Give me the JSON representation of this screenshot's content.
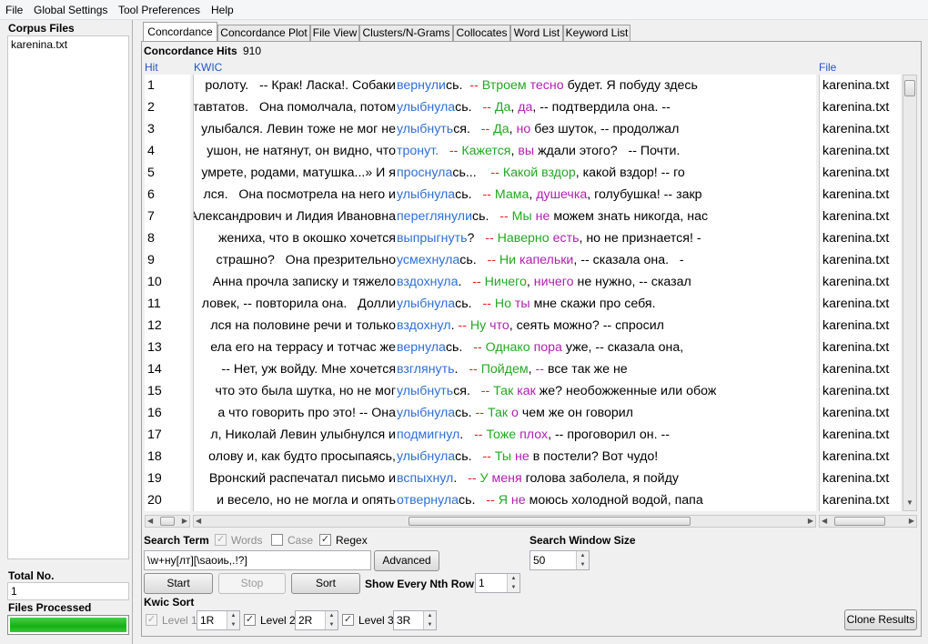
{
  "menu": [
    "File",
    "Global Settings",
    "Tool Preferences",
    "Help"
  ],
  "left": {
    "corpus_title": "Corpus Files",
    "files": [
      "karenina.txt"
    ],
    "total_label": "Total No.",
    "total_value": "1",
    "processed_label": "Files Processed",
    "progress": 1.0
  },
  "tabs": [
    "Concordance",
    "Concordance Plot",
    "File View",
    "Clusters/N-Grams",
    "Collocates",
    "Word List",
    "Keyword List"
  ],
  "hits": {
    "label": "Concordance Hits",
    "value": "910"
  },
  "columns": {
    "hit": "Hit",
    "kwic": "KWIC",
    "file": "File"
  },
  "rows": [
    {
      "hit": "1",
      "left": "ролоту.   -- Крак! Ласка!. Собаки",
      "right": [
        [
          "вернули",
          "blue"
        ],
        [
          "сь.  ",
          ""
        ],
        [
          "-- ",
          "red"
        ],
        [
          "Втроем ",
          "green"
        ],
        [
          "тесно",
          "purple"
        ],
        [
          " будет. Я побуду здесь",
          ""
        ]
      ],
      "file": "karenina.txt"
    },
    {
      "hit": "2",
      "left": "ставтатов.   Она помолчала, потом",
      "right": [
        [
          "улыбнула",
          "blue"
        ],
        [
          "сь.   ",
          ""
        ],
        [
          "-- ",
          "red"
        ],
        [
          "Да",
          "green"
        ],
        [
          ", ",
          ""
        ],
        [
          "да",
          "purple"
        ],
        [
          ", -- подтвердила она. --",
          ""
        ]
      ],
      "file": "karenina.txt"
    },
    {
      "hit": "3",
      "left": "улыбался. Левин тоже не мог не",
      "right": [
        [
          "улыбнуть",
          "blue"
        ],
        [
          "ся.   ",
          ""
        ],
        [
          "-- ",
          "red"
        ],
        [
          "Да",
          "green"
        ],
        [
          ", ",
          ""
        ],
        [
          "но",
          "purple"
        ],
        [
          " без шуток, -- продолжал",
          ""
        ]
      ],
      "file": "karenina.txt"
    },
    {
      "hit": "4",
      "left": "ушон, не натянут, он видно, что",
      "right": [
        [
          "тронут.",
          "blue"
        ],
        [
          "   ",
          ""
        ],
        [
          "-- ",
          "red"
        ],
        [
          "Кажется",
          "green"
        ],
        [
          ", ",
          ""
        ],
        [
          "вы",
          "purple"
        ],
        [
          " ждали этого?   -- Почти.",
          ""
        ]
      ],
      "file": "karenina.txt"
    },
    {
      "hit": "5",
      "left": "умрете, родами, матушка...» И я",
      "right": [
        [
          "проснула",
          "blue"
        ],
        [
          "сь...    ",
          ""
        ],
        [
          "-- ",
          "red"
        ],
        [
          "Какой вздор",
          "green"
        ],
        [
          ", какой вздор! -- го",
          ""
        ]
      ],
      "file": "karenina.txt"
    },
    {
      "hit": "6",
      "left": "лся.   Она посмотрела на него и",
      "right": [
        [
          "улыбнула",
          "blue"
        ],
        [
          "сь.   ",
          ""
        ],
        [
          "-- ",
          "red"
        ],
        [
          "Мама",
          "green"
        ],
        [
          ", ",
          ""
        ],
        [
          "душечка",
          "purple"
        ],
        [
          ", голубушка! -- закр",
          ""
        ]
      ],
      "file": "karenina.txt"
    },
    {
      "hit": "7",
      "left": "Александрович и Лидия Ивановна",
      "right": [
        [
          "переглянули",
          "blue"
        ],
        [
          "сь.   ",
          ""
        ],
        [
          "-- ",
          "red"
        ],
        [
          "Мы ",
          "green"
        ],
        [
          "не",
          "purple"
        ],
        [
          " можем знать никогда, нас",
          ""
        ]
      ],
      "file": "karenina.txt"
    },
    {
      "hit": "8",
      "left": "жениха, что в окошко хочется",
      "right": [
        [
          "выпрыгнуть",
          "blue"
        ],
        [
          "?   ",
          ""
        ],
        [
          "-- ",
          "red"
        ],
        [
          "Наверно ",
          "green"
        ],
        [
          "есть",
          "purple"
        ],
        [
          ", но не признается! -",
          ""
        ]
      ],
      "file": "karenina.txt"
    },
    {
      "hit": "9",
      "left": "страшно?   Она презрительно",
      "right": [
        [
          "усмехнула",
          "blue"
        ],
        [
          "сь.   ",
          ""
        ],
        [
          "-- ",
          "red"
        ],
        [
          "Ни ",
          "green"
        ],
        [
          "капельки",
          "purple"
        ],
        [
          ", -- сказала она.   -",
          ""
        ]
      ],
      "file": "karenina.txt"
    },
    {
      "hit": "10",
      "left": "Анна прочла записку и тяжело",
      "right": [
        [
          "вздохнула",
          "blue"
        ],
        [
          ".   ",
          ""
        ],
        [
          "-- ",
          "red"
        ],
        [
          "Ничего",
          "green"
        ],
        [
          ", ",
          ""
        ],
        [
          "ничего",
          "purple"
        ],
        [
          " не нужно, -- сказал",
          ""
        ]
      ],
      "file": "karenina.txt"
    },
    {
      "hit": "11",
      "left": "ловек, -- повторила она.   Долли",
      "right": [
        [
          "улыбнула",
          "blue"
        ],
        [
          "сь.   ",
          ""
        ],
        [
          "-- ",
          "red"
        ],
        [
          "Но ",
          "green"
        ],
        [
          "ты",
          "purple"
        ],
        [
          " мне скажи про себя.",
          ""
        ]
      ],
      "file": "karenina.txt"
    },
    {
      "hit": "12",
      "left": "лся на половине речи и только",
      "right": [
        [
          "вздохнул",
          "blue"
        ],
        [
          ". ",
          ""
        ],
        [
          "-- ",
          "red"
        ],
        [
          "Ну ",
          "green"
        ],
        [
          "что",
          "purple"
        ],
        [
          ", сеять можно? -- спросил",
          ""
        ]
      ],
      "file": "karenina.txt"
    },
    {
      "hit": "13",
      "left": "ела его на террасу и тотчас же",
      "right": [
        [
          "вернула",
          "blue"
        ],
        [
          "сь.   ",
          ""
        ],
        [
          "-- ",
          "red"
        ],
        [
          "Однако ",
          "green"
        ],
        [
          "пора",
          "purple"
        ],
        [
          " уже, -- сказала она,",
          ""
        ]
      ],
      "file": "karenina.txt"
    },
    {
      "hit": "14",
      "left": "-- Нет, уж войду. Мне хочется",
      "right": [
        [
          "взглянуть",
          "blue"
        ],
        [
          ".   ",
          ""
        ],
        [
          "-- ",
          "red"
        ],
        [
          "Пойдем",
          "green"
        ],
        [
          ", ",
          ""
        ],
        [
          "--",
          "purple"
        ],
        [
          " все так же не",
          ""
        ]
      ],
      "file": "karenina.txt"
    },
    {
      "hit": "15",
      "left": "что это была шутка, но не мог",
      "right": [
        [
          "улыбнуть",
          "blue"
        ],
        [
          "ся.   ",
          ""
        ],
        [
          "-- ",
          "red"
        ],
        [
          "Так ",
          "green"
        ],
        [
          "как",
          "purple"
        ],
        [
          " же? необожженные или обож",
          ""
        ]
      ],
      "file": "karenina.txt"
    },
    {
      "hit": "16",
      "left": "а что говорить про это! -- Она",
      "right": [
        [
          "улыбнула",
          "blue"
        ],
        [
          "сь. ",
          ""
        ],
        [
          "-- ",
          "red"
        ],
        [
          "Так ",
          "green"
        ],
        [
          "о",
          "purple"
        ],
        [
          " чем же он говорил",
          ""
        ]
      ],
      "file": "karenina.txt"
    },
    {
      "hit": "17",
      "left": "л, Николай Левин улыбнулся и",
      "right": [
        [
          "подмигнул",
          "blue"
        ],
        [
          ".   ",
          ""
        ],
        [
          "-- ",
          "red"
        ],
        [
          "Тоже ",
          "green"
        ],
        [
          "плох",
          "purple"
        ],
        [
          ", -- проговорил он. --",
          ""
        ]
      ],
      "file": "karenina.txt"
    },
    {
      "hit": "18",
      "left": "олову и, как будто просыпаясь,",
      "right": [
        [
          "улыбнула",
          "blue"
        ],
        [
          "сь.   ",
          ""
        ],
        [
          "-- ",
          "red"
        ],
        [
          "Ты ",
          "green"
        ],
        [
          "не",
          "purple"
        ],
        [
          " в постели? Вот чудо!",
          ""
        ]
      ],
      "file": "karenina.txt"
    },
    {
      "hit": "19",
      "left": "Вронский распечатал письмо и",
      "right": [
        [
          "вспыхнул",
          "blue"
        ],
        [
          ".   ",
          ""
        ],
        [
          "-- ",
          "red"
        ],
        [
          "У ",
          "green"
        ],
        [
          "меня",
          "purple"
        ],
        [
          " голова заболела, я пойду",
          ""
        ]
      ],
      "file": "karenina.txt"
    },
    {
      "hit": "20",
      "left": " и весело, но не могла и опять",
      "right": [
        [
          "отвернула",
          "blue"
        ],
        [
          "сь.   ",
          ""
        ],
        [
          "-- ",
          "red"
        ],
        [
          "Я ",
          "green"
        ],
        [
          "не",
          "purple"
        ],
        [
          " моюсь холодной водой, папа",
          ""
        ]
      ],
      "file": "karenina.txt"
    }
  ],
  "search": {
    "term_label": "Search Term",
    "words_label": "Words",
    "case_label": "Case",
    "regex_label": "Regex",
    "words_checked": true,
    "case_checked": false,
    "regex_checked": true,
    "query": "\\w+ну[лт][\\saоиь,.!?]",
    "advanced": "Advanced",
    "window_label": "Search Window Size",
    "window_value": "50"
  },
  "buttons": {
    "start": "Start",
    "stop": "Stop",
    "sort": "Sort",
    "clone": "Clone Results"
  },
  "nth": {
    "label": "Show Every Nth Row",
    "value": "1"
  },
  "kwic_sort": {
    "label": "Kwic Sort",
    "levels": [
      {
        "label": "Level 1",
        "value": "1R",
        "checked": true,
        "enabled": false
      },
      {
        "label": "Level 2",
        "value": "2R",
        "checked": true,
        "enabled": true
      },
      {
        "label": "Level 3",
        "value": "3R",
        "checked": true,
        "enabled": true
      }
    ]
  },
  "colors": {
    "node": "#2e6fd8",
    "level1": "#e02020",
    "level2": "#22a822",
    "level3": "#b020b0",
    "progress": "#22b422"
  }
}
